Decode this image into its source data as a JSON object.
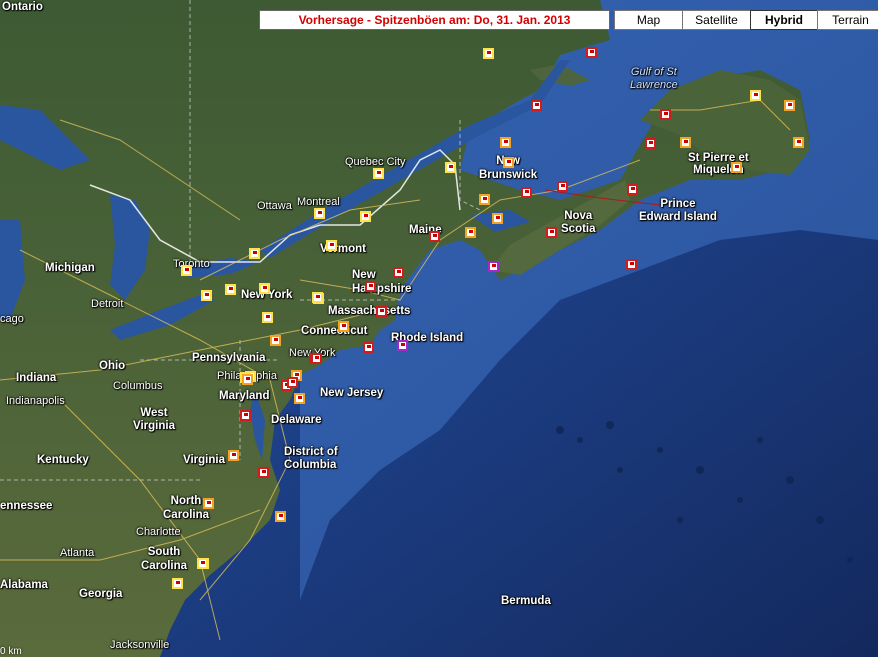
{
  "header": {
    "title": "Vorhersage - Spitzenböen am: Do, 31. Jan. 2013"
  },
  "map_types": [
    {
      "label": "Map",
      "active": false
    },
    {
      "label": "Satellite",
      "active": false
    },
    {
      "label": "Hybrid",
      "active": true
    },
    {
      "label": "Terrain",
      "active": false
    }
  ],
  "scale_text": "0 km",
  "labels": {
    "ontario": "Ontario",
    "michigan": "Michigan",
    "toronto": "Toronto",
    "detroit": "Detroit",
    "chicago": "cago",
    "ohio": "Ohio",
    "columbus": "Columbus",
    "indiana": "Indiana",
    "indianapolis": "Indianapolis",
    "west_virginia": "West\nVirginia",
    "kentucky": "Kentucky",
    "tennessee": "ennessee",
    "north_carolina": "North\nCarolina",
    "charlotte": "Charlotte",
    "south_carolina": "South\nCarolina",
    "atlanta": "Atlanta",
    "alabama": "Alabama",
    "georgia": "Georgia",
    "jacksonville": "Jacksonville",
    "virginia": "Virginia",
    "dc": "District of\nColumbia",
    "maryland": "Maryland",
    "delaware": "Delaware",
    "new_jersey": "New Jersey",
    "pennsylvania": "Pennsylvania",
    "philadelphia": "Philadelphia",
    "new_york_state": "New York",
    "new_york_city": "New York",
    "connecticut": "Connecticut",
    "massachusetts": "Massachusetts",
    "rhode_island": "Rhode Island",
    "new_hampshire": "New\nHampshire",
    "vermont": "Vermont",
    "maine": "Maine",
    "ottawa": "Ottawa",
    "montreal": "Montreal",
    "quebec_city": "Quebec City",
    "new_brunswick": "New\nBrunswick",
    "nova_scotia": "Nova\nScotia",
    "pei": "Prince\nEdward Island",
    "gulf": "Gulf of St\nLawrence",
    "st_pierre": "St Pierre et\nMiquelon",
    "bermuda": "Bermuda"
  },
  "markers": [
    {
      "c": "yellow"
    },
    {
      "c": "red"
    },
    {
      "c": "yellow"
    },
    {
      "c": "orange"
    },
    {
      "c": "orange"
    },
    {
      "c": "red"
    },
    {
      "c": "red"
    },
    {
      "c": "orange"
    },
    {
      "c": "red"
    },
    {
      "c": "orange"
    },
    {
      "c": "yellow"
    },
    {
      "c": "orange"
    },
    {
      "c": "yellow"
    },
    {
      "c": "red"
    },
    {
      "c": "red"
    },
    {
      "c": "red"
    },
    {
      "c": "orange"
    },
    {
      "c": "orange"
    },
    {
      "c": "orange"
    },
    {
      "c": "red"
    },
    {
      "c": "orange"
    },
    {
      "c": "red"
    },
    {
      "c": "yellow"
    },
    {
      "c": "yellow"
    },
    {
      "c": "yellow"
    },
    {
      "c": "red"
    },
    {
      "c": "red"
    },
    {
      "c": "orange"
    },
    {
      "c": "yellow"
    },
    {
      "c": "purple"
    },
    {
      "c": "red"
    },
    {
      "c": "yellow"
    },
    {
      "c": "yellow"
    },
    {
      "c": "yellow"
    },
    {
      "c": "yellow"
    },
    {
      "c": "yellow"
    },
    {
      "c": "red"
    },
    {
      "c": "red"
    },
    {
      "c": "orange"
    },
    {
      "c": "yellow"
    },
    {
      "c": "yellow"
    },
    {
      "c": "yellow"
    },
    {
      "c": "red"
    },
    {
      "c": "orange"
    },
    {
      "c": "red"
    },
    {
      "c": "orange"
    },
    {
      "c": "red"
    },
    {
      "c": "orange"
    },
    {
      "c": "orange"
    },
    {
      "c": "red"
    },
    {
      "c": "yellow"
    },
    {
      "c": "orange"
    },
    {
      "c": "yellow"
    },
    {
      "c": "orange"
    },
    {
      "c": "yellow"
    },
    {
      "c": "red"
    },
    {
      "c": "red"
    },
    {
      "c": "purple"
    },
    {
      "c": "yellow"
    },
    {
      "c": "red"
    }
  ]
}
